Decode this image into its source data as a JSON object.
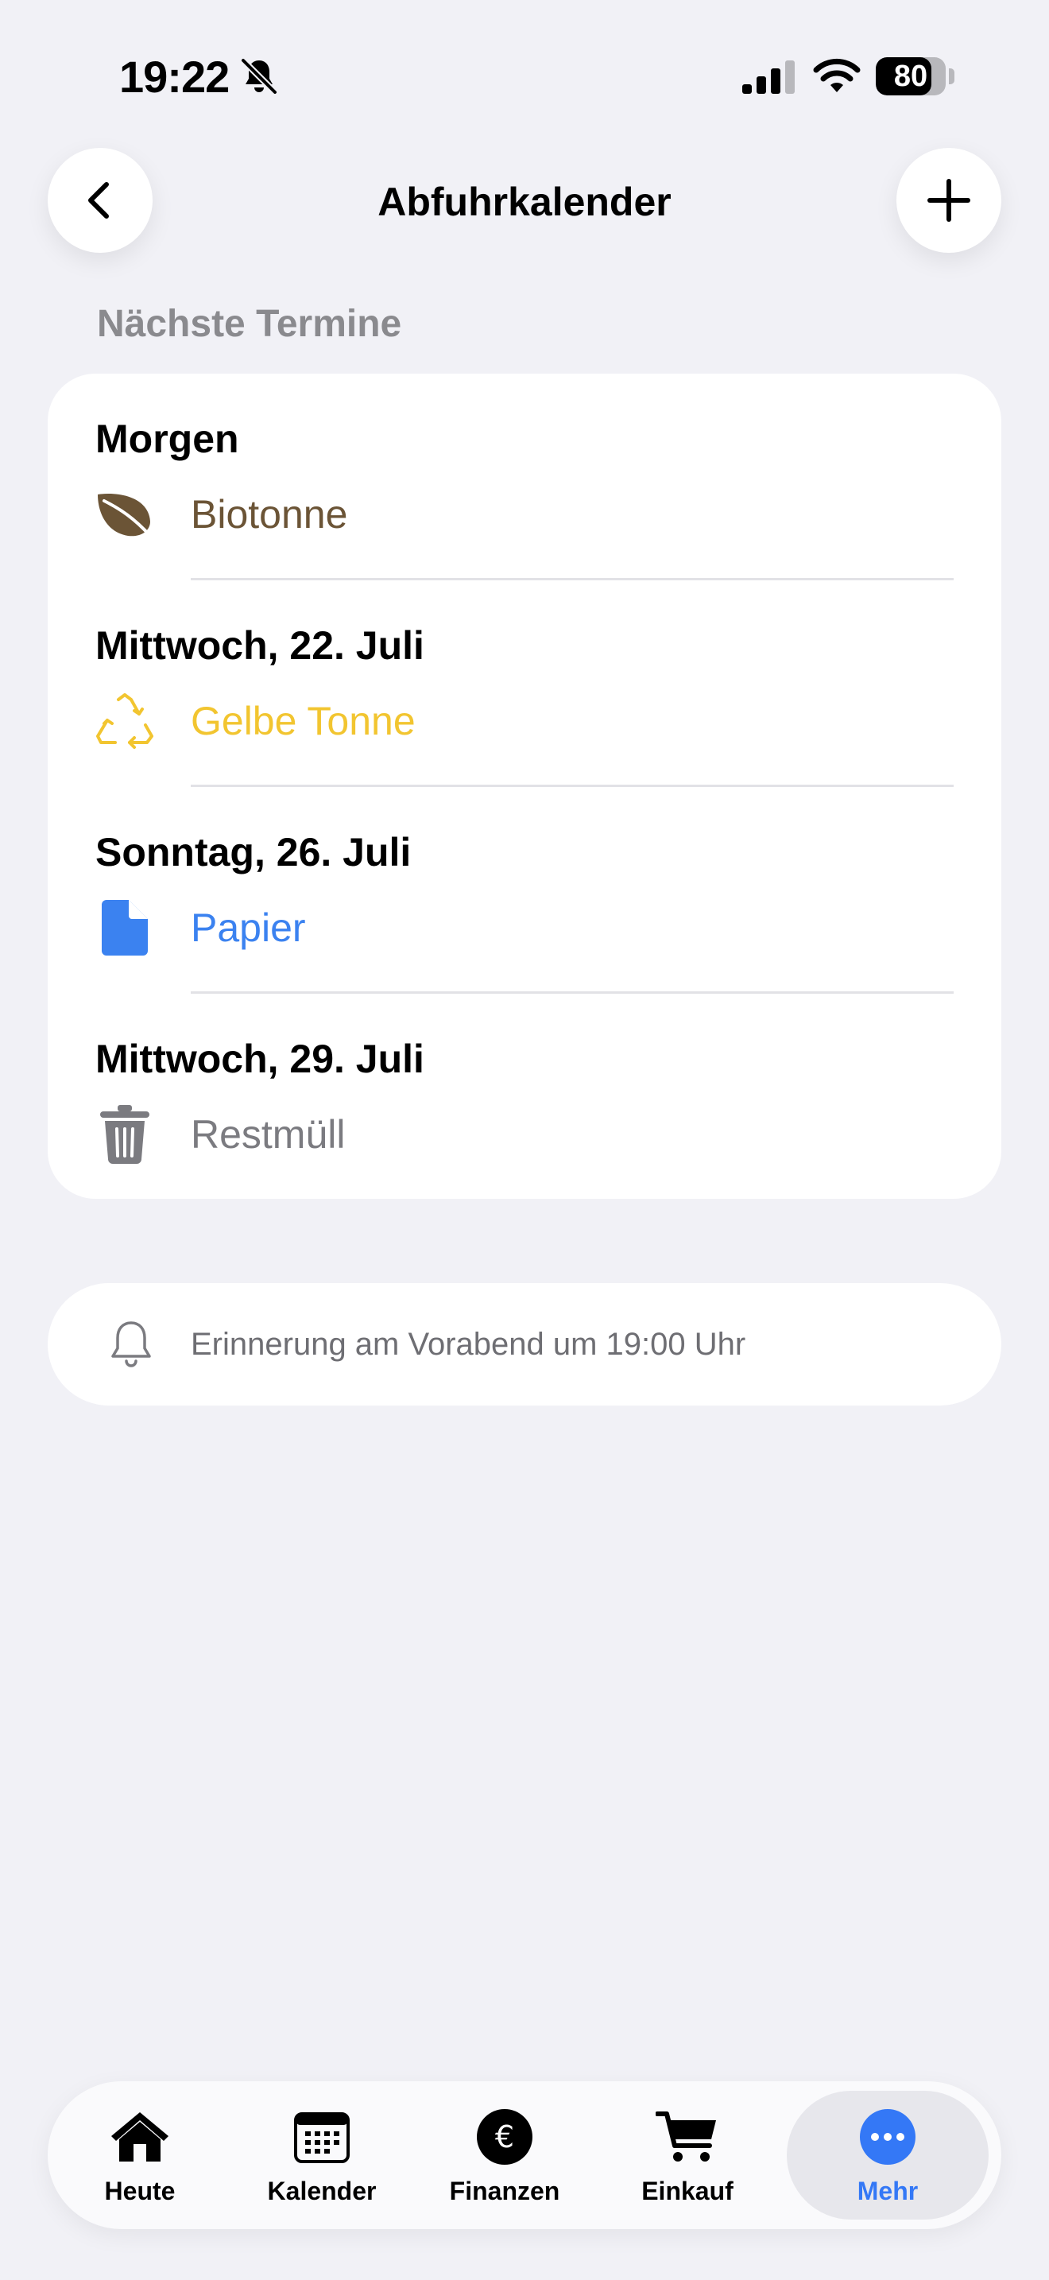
{
  "status_bar": {
    "time": "19:22",
    "battery": "80",
    "battery_level": 0.8,
    "icons": [
      "bell-slash-icon",
      "cellular-signal-icon",
      "wifi-icon",
      "battery-icon"
    ]
  },
  "nav": {
    "title": "Abfuhrkalender",
    "back_icon": "chevron-left-icon",
    "add_icon": "plus-icon"
  },
  "section_label": "Nächste Termine",
  "entries": [
    {
      "date": "Morgen",
      "type": "Biotonne",
      "icon": "leaf-icon",
      "color": "#6B5436"
    },
    {
      "date": "Mittwoch, 22. Juli",
      "type": "Gelbe Tonne",
      "icon": "recycle-icon",
      "color": "#F2C530"
    },
    {
      "date": "Sonntag, 26. Juli",
      "type": "Papier",
      "icon": "document-icon",
      "color": "#3B82F0"
    },
    {
      "date": "Mittwoch, 29. Juli",
      "type": "Restmüll",
      "icon": "trash-icon",
      "color": "#7B7B80"
    }
  ],
  "reminder": {
    "icon": "bell-icon",
    "text": "Erinnerung am Vorabend um 19:00 Uhr"
  },
  "tabbar": {
    "active": "Mehr",
    "accent": "#3478F6",
    "tabs": [
      {
        "label": "Heute",
        "icon": "house-icon"
      },
      {
        "label": "Kalender",
        "icon": "calendar-icon"
      },
      {
        "label": "Finanzen",
        "icon": "euro-circle-icon"
      },
      {
        "label": "Einkauf",
        "icon": "cart-icon"
      },
      {
        "label": "Mehr",
        "icon": "ellipsis-circle-icon"
      }
    ]
  }
}
